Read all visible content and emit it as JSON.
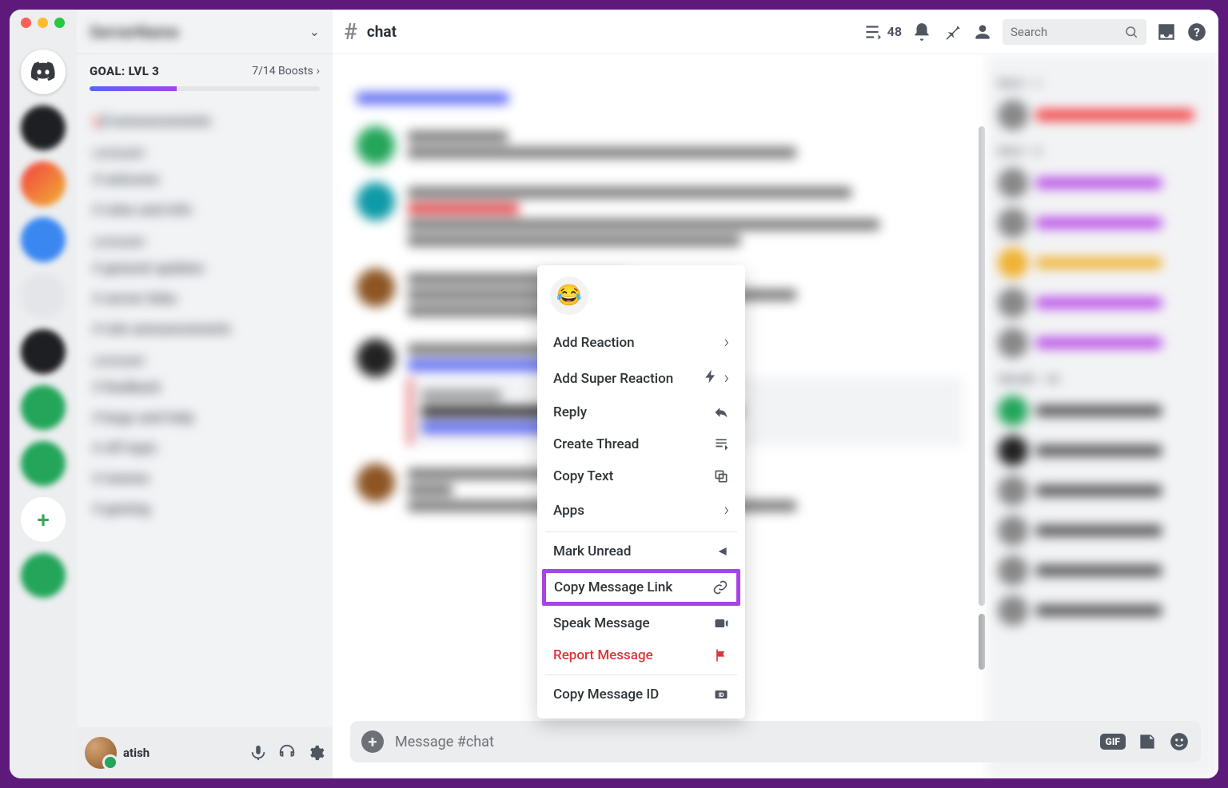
{
  "window": {
    "traffic": [
      "close",
      "minimize",
      "maximize"
    ]
  },
  "goal": {
    "label": "GOAL: LVL 3",
    "boosts_current": 7,
    "boosts_total": 14,
    "boosts_text": "7/14 Boosts"
  },
  "channel_header": {
    "name": "chat",
    "thread_count": 48
  },
  "search": {
    "placeholder": "Search"
  },
  "user": {
    "name": "atish"
  },
  "message_input": {
    "placeholder": "Message #chat",
    "gif_label": "GIF"
  },
  "context_menu": {
    "quick_emoji": "😂",
    "items": [
      {
        "label": "Add Reaction",
        "icon": "chevron-right",
        "type": "submenu"
      },
      {
        "label": "Add Super Reaction",
        "icon": "super-chevron",
        "type": "submenu"
      },
      {
        "label": "Reply",
        "icon": "reply"
      },
      {
        "label": "Create Thread",
        "icon": "thread"
      },
      {
        "label": "Copy Text",
        "icon": "copy"
      },
      {
        "label": "Apps",
        "icon": "chevron-right",
        "type": "submenu"
      },
      {
        "label": "Mark Unread",
        "icon": "mark-unread"
      },
      {
        "label": "Copy Message Link",
        "icon": "link",
        "highlight": true
      },
      {
        "label": "Speak Message",
        "icon": "speak"
      },
      {
        "label": "Report Message",
        "icon": "flag",
        "danger": true
      },
      {
        "label": "Copy Message ID",
        "icon": "id"
      }
    ]
  },
  "colors": {
    "accent_purple": "#a644e8",
    "brand_blurple": "#5865f2",
    "danger": "#da373c",
    "outer_frame": "#5e1a7a"
  }
}
